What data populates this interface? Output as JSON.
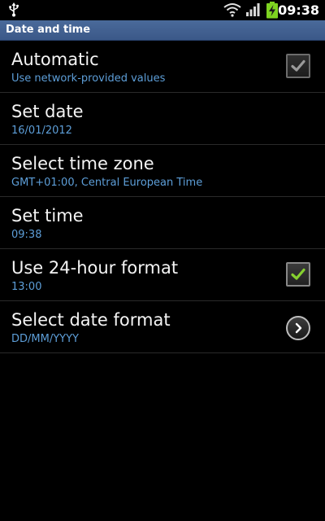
{
  "status_bar": {
    "time": "09:38",
    "icons": [
      "usb-icon",
      "wifi-icon",
      "signal-icon",
      "battery-charging-icon"
    ],
    "battery_color": "#7ed321"
  },
  "title_bar": {
    "title": "Date and time"
  },
  "settings": [
    {
      "title": "Automatic",
      "summary": "Use network-provided values",
      "control": "checkbox",
      "checked": true,
      "enabled": false
    },
    {
      "title": "Set date",
      "summary": "16/01/2012",
      "control": "none"
    },
    {
      "title": "Select time zone",
      "summary": "GMT+01:00, Central European Time",
      "control": "none"
    },
    {
      "title": "Set time",
      "summary": "09:38",
      "control": "none"
    },
    {
      "title": "Use 24-hour format",
      "summary": "13:00",
      "control": "checkbox",
      "checked": true,
      "enabled": true
    },
    {
      "title": "Select date format",
      "summary": "DD/MM/YYYY",
      "control": "chevron-right-icon"
    }
  ],
  "colors": {
    "summary_text": "#5d9ed8",
    "title_bar": "#3b5888",
    "check_active": "#86d12f",
    "check_disabled": "#9a9a9a"
  }
}
